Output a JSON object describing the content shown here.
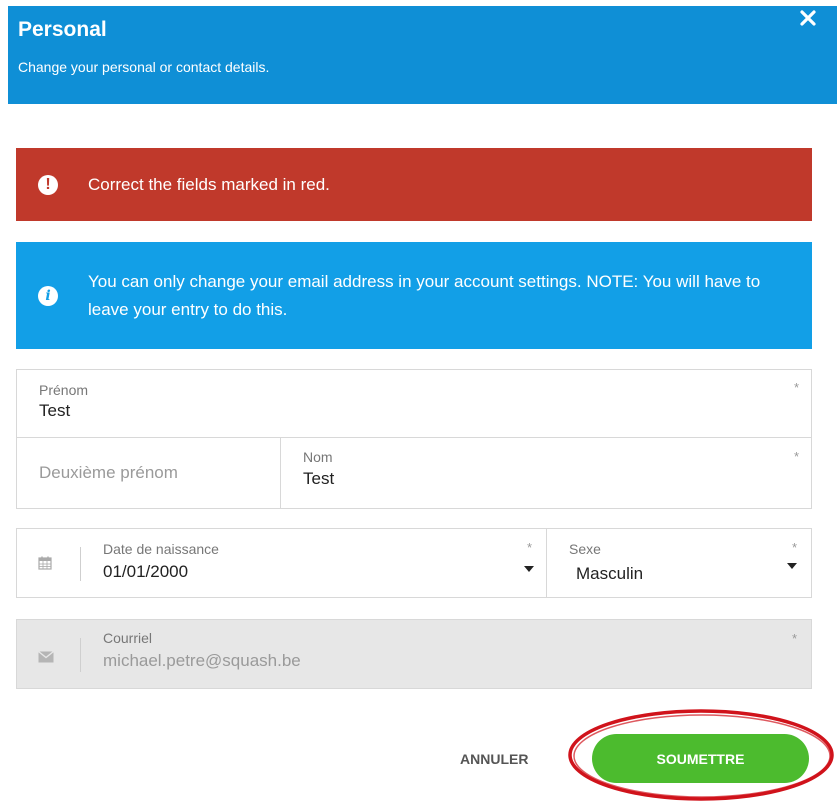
{
  "header": {
    "title": "Personal",
    "subtitle": "Change your personal or contact details.",
    "close_icon": "close-icon"
  },
  "alerts": {
    "error": {
      "icon": "exclamation-circle-icon",
      "text": "Correct the fields marked in red."
    },
    "info": {
      "icon": "info-circle-icon",
      "text": "You can only change your email address in your account settings. NOTE: You will have to leave your entry to do this."
    }
  },
  "form": {
    "first_name": {
      "label": "Prénom",
      "value": "Test",
      "required_mark": "*"
    },
    "middle_name": {
      "placeholder": "Deuxième prénom"
    },
    "last_name": {
      "label": "Nom",
      "value": "Test",
      "required_mark": "*"
    },
    "birth_date": {
      "icon": "calendar-icon",
      "label": "Date de naissance",
      "value": "01/01/2000",
      "required_mark": "*"
    },
    "gender": {
      "label": "Sexe",
      "value": "Masculin",
      "required_mark": "*"
    },
    "email": {
      "icon": "envelope-icon",
      "label": "Courriel",
      "value": "michael.petre@squash.be",
      "required_mark": "*"
    }
  },
  "footer": {
    "cancel_label": "ANNULER",
    "submit_label": "SOUMETTRE"
  },
  "colors": {
    "header_bg": "#0f8fd6",
    "error_bg": "#c0392b",
    "info_bg": "#129fe7",
    "submit_bg": "#4cbb2e",
    "annotation_ellipse": "#d0131b"
  }
}
